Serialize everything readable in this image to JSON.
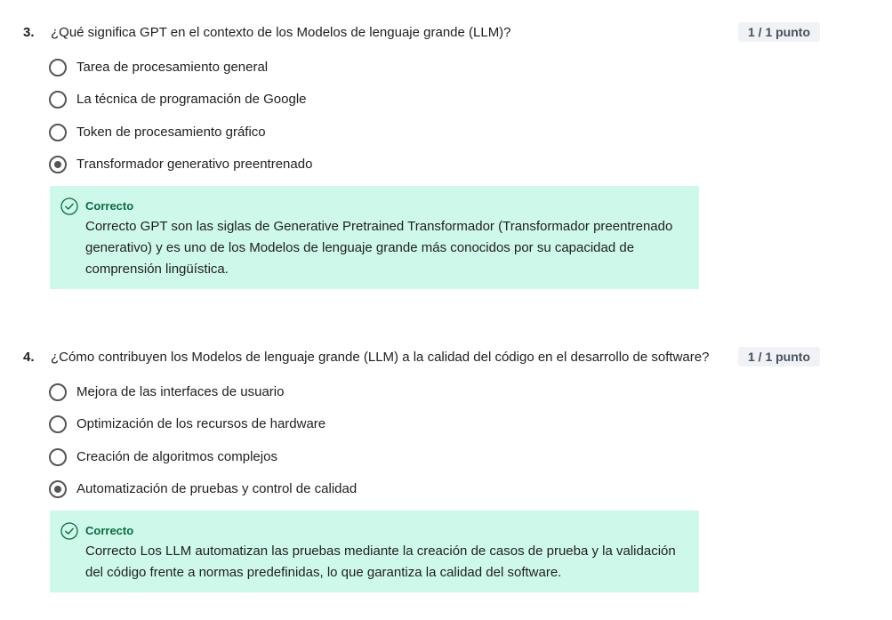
{
  "questions": [
    {
      "number": "3.",
      "text": "¿Qué significa GPT en el contexto de los Modelos de lenguaje grande (LLM)?",
      "score": "1 / 1 punto",
      "options": [
        {
          "label": "Tarea de procesamiento general",
          "selected": false
        },
        {
          "label": "La técnica de programación de Google",
          "selected": false
        },
        {
          "label": "Token de procesamiento gráfico",
          "selected": false
        },
        {
          "label": "Transformador generativo preentrenado",
          "selected": true
        }
      ],
      "feedback": {
        "icon": "check-circle-icon",
        "title": "Correcto",
        "text": "Correcto GPT son las siglas de Generative Pretrained Transformador (Transformador preentrenado generativo) y es uno de los Modelos de lenguaje grande más conocidos por su capacidad de comprensión lingüística."
      }
    },
    {
      "number": "4.",
      "text": "¿Cómo contribuyen los Modelos de lenguaje grande (LLM) a la calidad del código en el desarrollo de software?",
      "score": "1 / 1 punto",
      "options": [
        {
          "label": "Mejora de las interfaces de usuario",
          "selected": false
        },
        {
          "label": "Optimización de los recursos de hardware",
          "selected": false
        },
        {
          "label": "Creación de algoritmos complejos",
          "selected": false
        },
        {
          "label": "Automatización de pruebas y control de calidad",
          "selected": true
        }
      ],
      "feedback": {
        "icon": "check-circle-icon",
        "title": "Correcto",
        "text": "Correcto Los LLM automatizan las pruebas mediante la creación de casos de prueba y la validación del código frente a normas predefinidas, lo que garantiza la calidad del software."
      }
    }
  ],
  "colors": {
    "feedback_bg": "#cef8ea",
    "correct_green": "#0b6b42",
    "score_bg": "#f0f2f5"
  }
}
